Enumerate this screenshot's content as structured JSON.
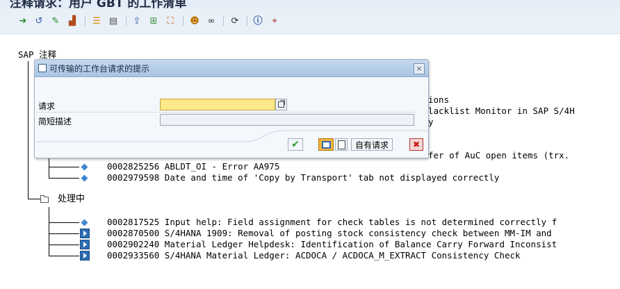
{
  "window": {
    "title": "注释请求：用户 GBT 的工作清单"
  },
  "toolbar": {
    "icons": [
      "execute-icon",
      "refresh-icon",
      "check-icon",
      "hierarchy-icon",
      "sort-icon",
      "display-icon",
      "export-icon",
      "tree-icon",
      "chart-icon",
      "glasses-icon",
      "transport-icon",
      "info-icon",
      "help-cursor-icon"
    ]
  },
  "tree": {
    "root": "SAP 注释",
    "partial_lines": [
      "ions",
      "lacklist Monitor in SAP S/4H",
      "y",
      "fer of AuC open items (trx."
    ],
    "group1": [
      {
        "id": "0002825256",
        "text": "ABLDT_OI - Error AA975"
      },
      {
        "id": "0002979598",
        "text": "Date and time of 'Copy by Transport' tab not displayed correctly"
      }
    ],
    "folder_label": "处理中",
    "group2": [
      {
        "id": "0002817525",
        "text": "Input help: Field assignment for check tables is not determined correctly f"
      },
      {
        "id": "0002870500",
        "text": "S/4HANA 1909: Removal of posting stock consistency check between MM-IM and"
      },
      {
        "id": "0002902240",
        "text": "Material Ledger Helpdesk: Identification of Balance Carry Forward Inconsist"
      },
      {
        "id": "0002933560",
        "text": "S/4HANA Material Ledger: ACDOCA / ACDOCA_M_EXTRACT Consistency Check"
      }
    ]
  },
  "dialog": {
    "title": "可传输的工作台请求的提示",
    "request_label": "请求",
    "request_value": "",
    "description_label": "简短描述",
    "description_value": "",
    "own_requests_label": "自有请求",
    "close_glyph": "×",
    "ok_glyph": "✔",
    "cancel_glyph": "✖"
  }
}
